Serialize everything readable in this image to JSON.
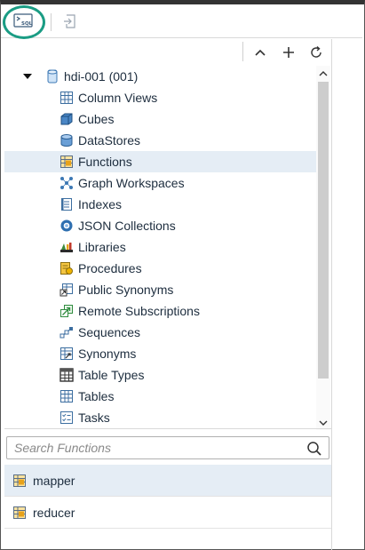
{
  "toolbar": {
    "sql_button_icon": "sql-console-icon",
    "import_button_icon": "import-icon"
  },
  "tree_toolbar": {
    "collapse_icon": "chevron-up-icon",
    "add_icon": "plus-icon",
    "refresh_icon": "refresh-icon"
  },
  "tree": {
    "root": {
      "label": "hdi-001 (001)",
      "expanded": true
    },
    "items": [
      {
        "label": "Column Views",
        "icon": "column-views-icon"
      },
      {
        "label": "Cubes",
        "icon": "cube-icon"
      },
      {
        "label": "DataStores",
        "icon": "datastore-icon"
      },
      {
        "label": "Functions",
        "icon": "function-icon",
        "selected": true
      },
      {
        "label": "Graph Workspaces",
        "icon": "graph-workspace-icon"
      },
      {
        "label": "Indexes",
        "icon": "index-icon"
      },
      {
        "label": "JSON Collections",
        "icon": "json-collection-icon"
      },
      {
        "label": "Libraries",
        "icon": "library-icon"
      },
      {
        "label": "Procedures",
        "icon": "procedure-icon"
      },
      {
        "label": "Public Synonyms",
        "icon": "public-synonym-icon"
      },
      {
        "label": "Remote Subscriptions",
        "icon": "remote-subscription-icon"
      },
      {
        "label": "Sequences",
        "icon": "sequence-icon"
      },
      {
        "label": "Synonyms",
        "icon": "synonym-icon"
      },
      {
        "label": "Table Types",
        "icon": "table-type-icon"
      },
      {
        "label": "Tables",
        "icon": "table-icon"
      },
      {
        "label": "Tasks",
        "icon": "task-icon"
      }
    ]
  },
  "search": {
    "placeholder": "Search Functions",
    "value": ""
  },
  "results": [
    {
      "label": "mapper",
      "selected": true
    },
    {
      "label": "reducer",
      "selected": false
    }
  ],
  "colors": {
    "highlight_ring": "#1a9c84",
    "selection": "#e5edf5",
    "text": "#1d2d3e"
  }
}
